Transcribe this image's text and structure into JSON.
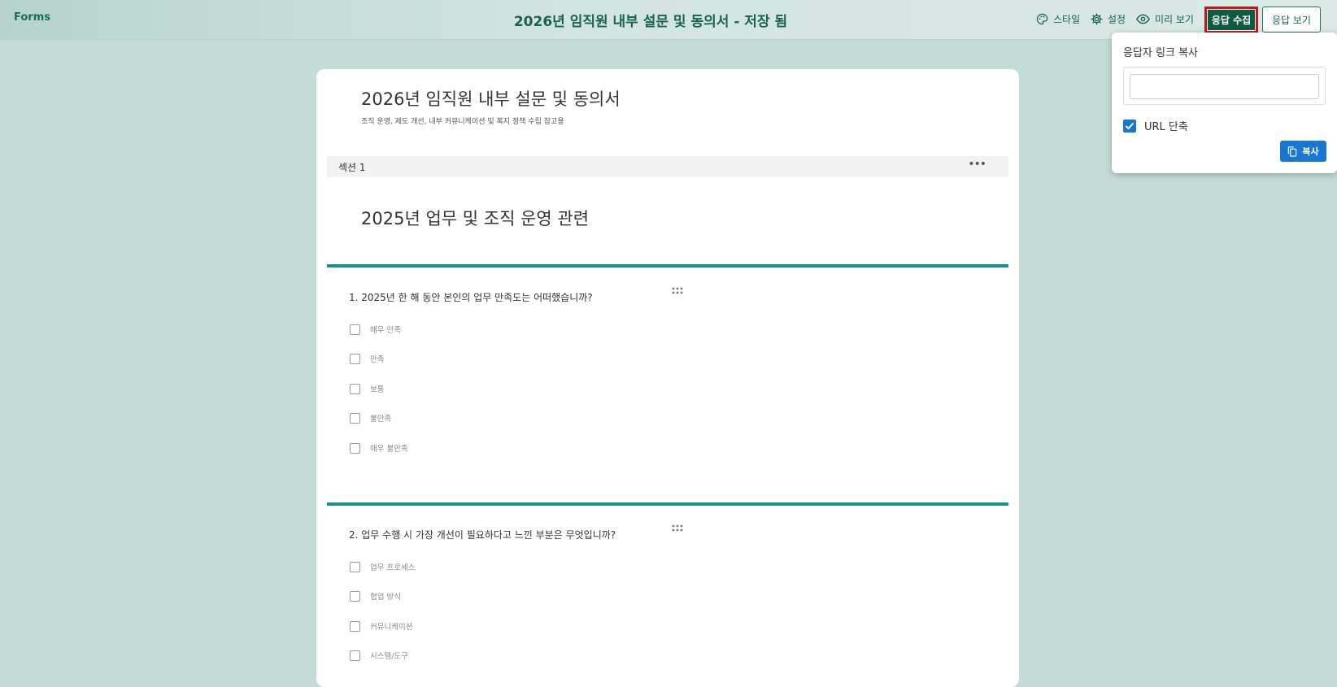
{
  "header": {
    "brand": "Forms",
    "title": "2026년 임직원 내부 설문 및 동의서 - 저장 됨",
    "style_label": "스타일",
    "settings_label": "설정",
    "preview_label": "미리 보기",
    "collect_label": "응답 수집",
    "view_responses_label": "응답 보기"
  },
  "form": {
    "title": "2026년 임직원 내부 설문 및 동의서",
    "description": "조직 운영, 제도 개선, 내부 커뮤니케이션 및 복지 정책 수립 참고용",
    "section_label": "섹션 1",
    "section_more": "•••",
    "section_heading": "2025년 업무 및 조직 운영 관련",
    "questions": [
      {
        "text": "1. 2025년 한 해 동안 본인의 업무 만족도는 어떠했습니까?",
        "options": [
          "매우 만족",
          "만족",
          "보통",
          "불만족",
          "매우 불만족"
        ]
      },
      {
        "text": "2. 업무 수행 시 가장 개선이 필요하다고 느낀 부분은 무엇입니까?",
        "options": [
          "업무 프로세스",
          "협업 방식",
          "커뮤니케이션",
          "시스템/도구"
        ]
      }
    ]
  },
  "popup": {
    "title": "응답자 링크 복사",
    "url_value": "",
    "shorten_label": "URL 단축",
    "shorten_checked": true,
    "copy_label": "복사"
  },
  "colors": {
    "accent": "#14928f",
    "primary_dark": "#0e5a43",
    "highlight_border": "#c4161c",
    "popup_button": "#1976d2"
  }
}
